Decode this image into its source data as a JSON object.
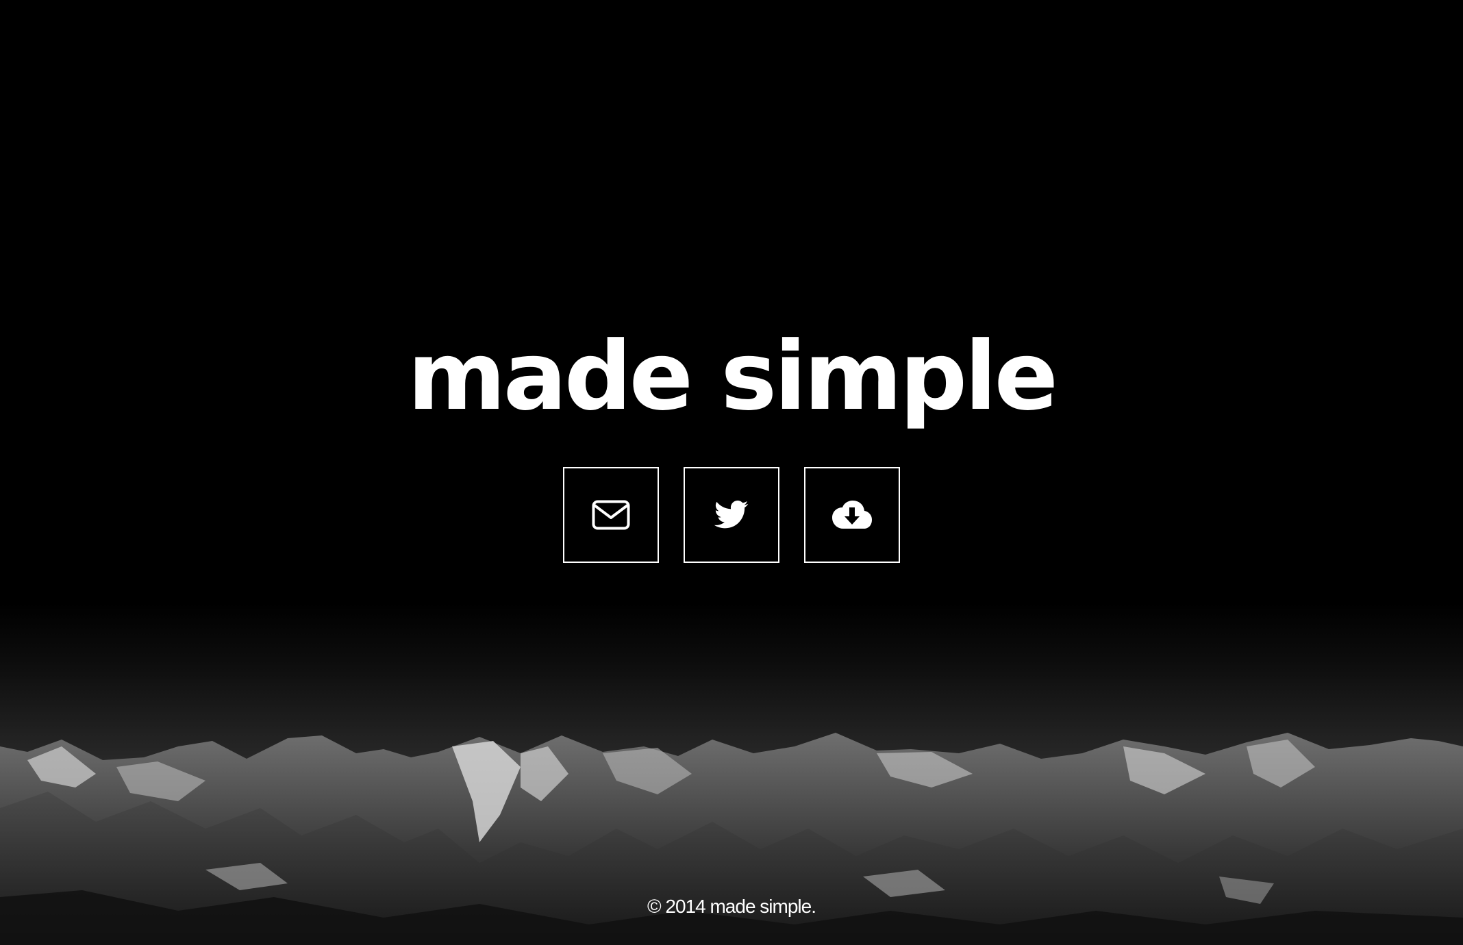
{
  "header": {
    "title": "made simple"
  },
  "social": {
    "buttons": [
      {
        "icon": "envelope-icon"
      },
      {
        "icon": "twitter-icon"
      },
      {
        "icon": "cloud-download-icon"
      }
    ]
  },
  "footer": {
    "copyright": "© 2014 made simple."
  },
  "colors": {
    "background": "#000000",
    "foreground": "#ffffff"
  }
}
